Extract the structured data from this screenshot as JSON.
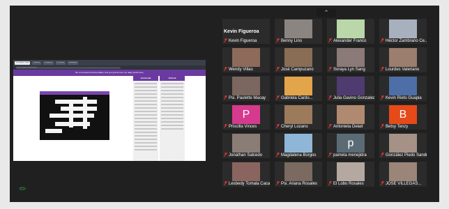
{
  "app": {
    "collapse_icon": "chevron-up-icon"
  },
  "shared_screen": {
    "browser_tabs": [
      "Los Lumpias - Gmail",
      "Proyectos",
      "Crucigrama",
      "G. Drawing",
      "Puzzlemaker"
    ],
    "address_bar": "puzzle-crossword.com/crossword",
    "banner": "Be a Crossword Puzzle Maker, find you puzzle from our daily puzzle here",
    "panel_across": "Horizontal",
    "panel_down": "Vertical",
    "grid_color": "#7b45b2"
  },
  "speaker": {
    "name": "Kevin Figueroa"
  },
  "participants": [
    {
      "name": "Kevin Figueroa",
      "vid": "#333",
      "letter": ""
    },
    {
      "name": "Benny Lino",
      "vid": "#8a8580",
      "letter": ""
    },
    {
      "name": "Alexander Franco",
      "vid": "#b9d7a8",
      "letter": ""
    },
    {
      "name": "Héctor Zambrano Ce...",
      "vid": "#a7b1be",
      "letter": ""
    },
    {
      "name": "Wendy Villao",
      "vid": "#8d6a5a",
      "letter": ""
    },
    {
      "name": "Josè Campuzano",
      "vid": "#8a6d55",
      "letter": ""
    },
    {
      "name": "Soraya Lyn Sang",
      "vid": "#8c7a78",
      "letter": ""
    },
    {
      "name": "Lourdes Valeriano",
      "vid": "#9c7e6e",
      "letter": ""
    },
    {
      "name": "Psi. Paulette Macay",
      "vid": "#7c6660",
      "letter": ""
    },
    {
      "name": "Gabriela Cardo...",
      "vid": "#e3a54a",
      "letter": ""
    },
    {
      "name": "Julia Gavino Gonzalez",
      "vid": "#4f3b70",
      "letter": ""
    },
    {
      "name": "Kevin Rieto Guapia",
      "vid": "#4e6ea8",
      "letter": ""
    },
    {
      "name": "Priscilla Vinces",
      "vid": "#d63a8e",
      "letter": "P"
    },
    {
      "name": "Cheryl Lozano",
      "vid": "#9b7b5c",
      "letter": ""
    },
    {
      "name": "Antonieta Delait",
      "vid": "#b08a70",
      "letter": ""
    },
    {
      "name": "Betsy Tenzy",
      "vid": "#e64a19",
      "letter": "B"
    },
    {
      "name": "Jonathan Salcedo",
      "vid": "#8a7d76",
      "letter": ""
    },
    {
      "name": "Magdalena Búrgos",
      "vid": "#8fb6d6",
      "letter": ""
    },
    {
      "name": "pamela menejidra",
      "vid": "#5a6b75",
      "letter": "p"
    },
    {
      "name": "González Piedo Sandr...",
      "vid": "#a59185",
      "letter": ""
    },
    {
      "name": "Lesbedy Tomala Cacao",
      "vid": "#8a655f",
      "letter": ""
    },
    {
      "name": "Psi. Ariana Rosales",
      "vid": "#7b6a60",
      "letter": ""
    },
    {
      "name": "El Lobo Rosales",
      "vid": "#b5a8a0",
      "letter": ""
    },
    {
      "name": "JOSÉ VILLEGAS...",
      "vid": "#9a8578",
      "letter": ""
    }
  ]
}
